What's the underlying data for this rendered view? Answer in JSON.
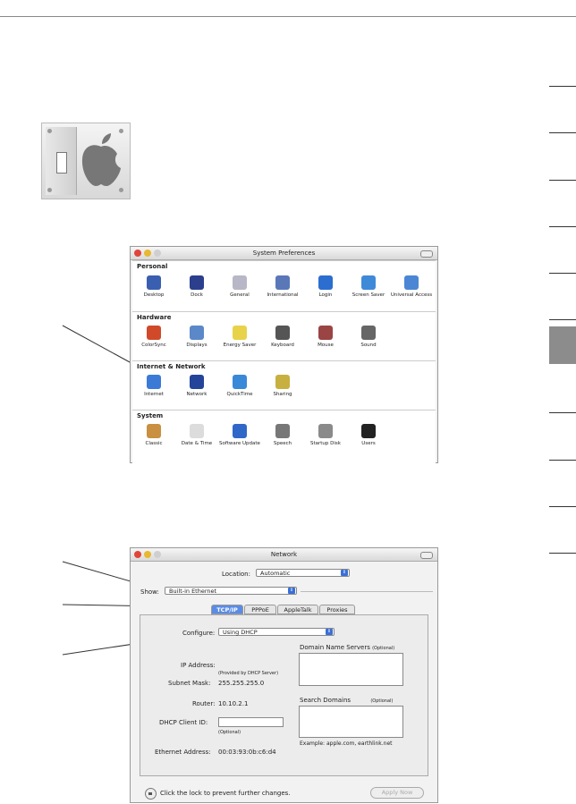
{
  "sysprefs": {
    "title": "System Preferences",
    "sections": [
      {
        "label": "Personal",
        "items": [
          {
            "name": "Desktop",
            "color": "#3a5fb0"
          },
          {
            "name": "Dock",
            "color": "#2b3f8c"
          },
          {
            "name": "General",
            "color": "#b7b7c7"
          },
          {
            "name": "International",
            "color": "#5a78b8"
          },
          {
            "name": "Login",
            "color": "#2c6ed0"
          },
          {
            "name": "Screen Saver",
            "color": "#3f8ad8"
          },
          {
            "name": "Universal Access",
            "color": "#4a86d4"
          }
        ]
      },
      {
        "label": "Hardware",
        "items": [
          {
            "name": "ColorSync",
            "color": "#d04a2a"
          },
          {
            "name": "Displays",
            "color": "#5b88c8"
          },
          {
            "name": "Energy Saver",
            "color": "#e8d24a"
          },
          {
            "name": "Keyboard",
            "color": "#555555"
          },
          {
            "name": "Mouse",
            "color": "#9a4444"
          },
          {
            "name": "Sound",
            "color": "#666666"
          }
        ]
      },
      {
        "label": "Internet & Network",
        "items": [
          {
            "name": "Internet",
            "color": "#3c7ad8"
          },
          {
            "name": "Network",
            "color": "#24449a"
          },
          {
            "name": "QuickTime",
            "color": "#3a88d8"
          },
          {
            "name": "Sharing",
            "color": "#c8b040"
          }
        ]
      },
      {
        "label": "System",
        "items": [
          {
            "name": "Classic",
            "color": "#c89040"
          },
          {
            "name": "Date & Time",
            "color": "#dcdcdc"
          },
          {
            "name": "Software Update",
            "color": "#3068c8"
          },
          {
            "name": "Speech",
            "color": "#777777"
          },
          {
            "name": "Startup Disk",
            "color": "#8a8a8a"
          },
          {
            "name": "Users",
            "color": "#222222"
          }
        ]
      }
    ]
  },
  "network": {
    "title": "Network",
    "location_label": "Location:",
    "location_value": "Automatic",
    "show_label": "Show:",
    "show_value": "Built-in Ethernet",
    "tabs": [
      "TCP/IP",
      "PPPoE",
      "AppleTalk",
      "Proxies"
    ],
    "configure_label": "Configure:",
    "configure_value": "Using DHCP",
    "dns_label": "Domain Name Servers",
    "dns_optional": "(Optional)",
    "ip_label": "IP Address:",
    "ip_note": "(Provided by DHCP Server)",
    "subnet_label": "Subnet Mask:",
    "subnet_value": "255.255.255.0",
    "router_label": "Router:",
    "router_value": "10.10.2.1",
    "search_label": "Search Domains",
    "search_optional": "(Optional)",
    "dhcp_label": "DHCP Client ID:",
    "dhcp_optional": "(Optional)",
    "example": "Example: apple.com, earthlink.net",
    "ethernet_label": "Ethernet Address:",
    "ethernet_value": "00:03:93:0b:c6:d4",
    "lock_text": "Click the lock to prevent further changes.",
    "apply_button": "Apply Now"
  }
}
